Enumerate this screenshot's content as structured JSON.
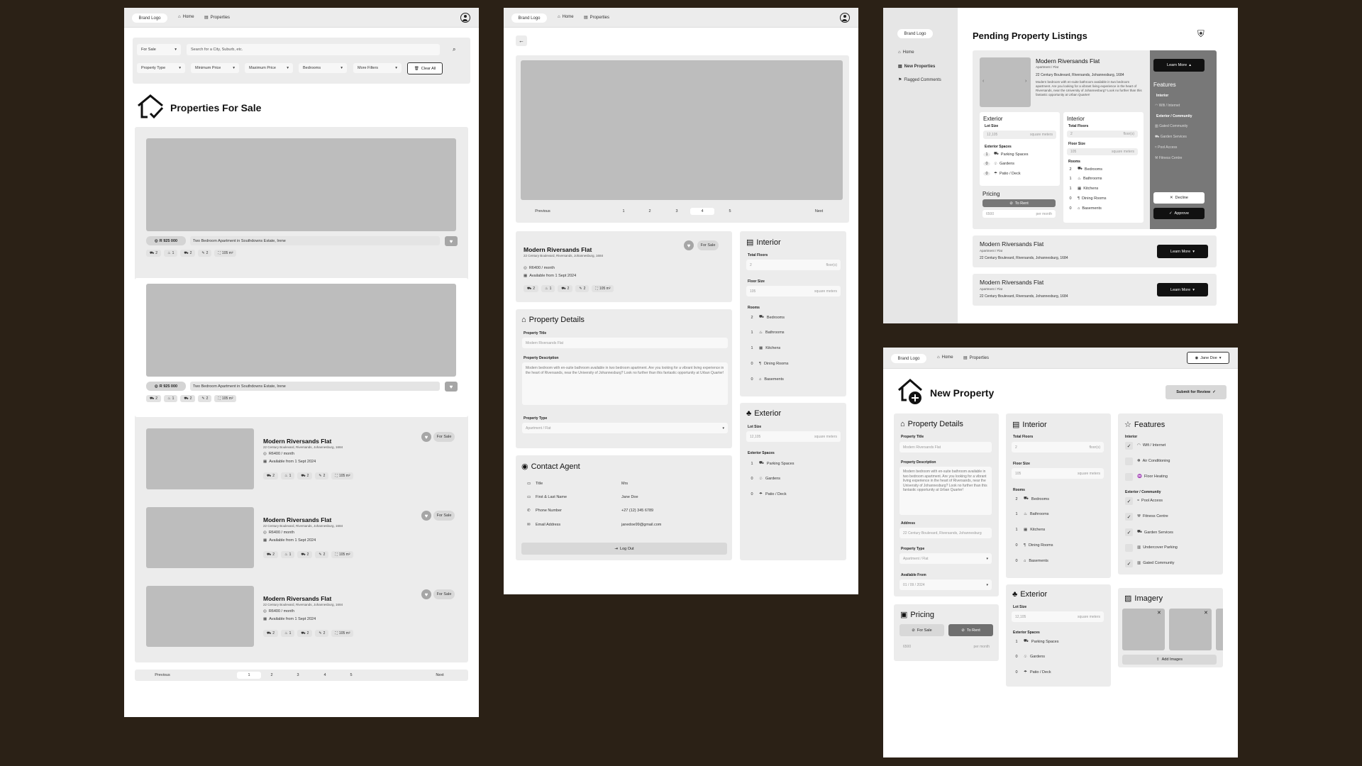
{
  "common": {
    "brand": "Brand Logo",
    "home": "Home",
    "properties": "Properties",
    "new_properties": "New Properties",
    "flagged": "Flagged Comments",
    "user": "Jane Doe"
  },
  "search": {
    "for_sale": "For Sale",
    "placeholder": "Search for a City, Suburb, etc.",
    "property_type": "Property Type",
    "min_price": "Minimum Price",
    "max_price": "Maximum Price",
    "bedrooms": "Bedrooms",
    "more_filters": "More Filters",
    "clear_all": "Clear All"
  },
  "list_page": {
    "heading": "Properties For Sale",
    "featured": [
      {
        "price": "R 925 000",
        "desc": "Two Bedroom Apartment in Southdowns Estate, Irene"
      },
      {
        "price": "R 925 000",
        "desc": "Two Bedroom Apartment in Southdowns Estate, Irene"
      }
    ],
    "chips": [
      "2",
      "1",
      "2",
      "2",
      "105 m²"
    ],
    "listings": [
      {
        "title": "Modern Riversands Flat",
        "address": "22 Century Boulevard, Riversands, Johannesburg, 1684",
        "price": "R6400 / month",
        "available": "Available from 1 Sept 2024",
        "tag": "For Sale"
      },
      {
        "title": "Modern Riversands Flat",
        "address": "22 Century Boulevard, Riversands, Johannesburg, 1684",
        "price": "R6400 / month",
        "available": "Available from 1 Sept 2024",
        "tag": "For Sale"
      },
      {
        "title": "Modern Riversands Flat",
        "address": "22 Century Boulevard, Riversands, Johannesburg, 1684",
        "price": "R6400 / month",
        "available": "Available from 1 Sept 2024",
        "tag": "For Sale"
      }
    ],
    "pager": {
      "prev": "Previous",
      "next": "Next",
      "pages": [
        "1",
        "2",
        "3",
        "4",
        "5"
      ],
      "active": 1
    }
  },
  "detail_page": {
    "pager": {
      "prev": "Previous",
      "next": "Next",
      "pages": [
        "1",
        "2",
        "3",
        "4",
        "5"
      ],
      "active": 4
    },
    "title": "Modern Riversands Flat",
    "address": "22 Century Boulevard, Riversands, Johannesburg, 1684",
    "price": "R6400 / month",
    "available": "Available from 1 Sept 2024",
    "tag": "For Sale",
    "details_heading": "Property Details",
    "property_title_label": "Property Title",
    "property_title_value": "Modern Riversands Flat",
    "desc_label": "Property Description",
    "desc_value": "Modern bedroom with en-suite bathroom available in two bedroom apartment. Are you looking for a vibrant living experience in the heart of Riversands, near the University of Johannesburg? Look no further than this fantastic opportunity at Urban Quarter!",
    "type_label": "Property Type",
    "type_value": "Apartment / Flat",
    "contact_heading": "Contact Agent",
    "contact": [
      {
        "label": "Title",
        "value": "Mrs"
      },
      {
        "label": "First & Last Name",
        "value": "Jane Doe"
      },
      {
        "label": "Phone Number",
        "value": "+27 (12) 345 6789"
      },
      {
        "label": "Email Address",
        "value": "janedoe99@gmail.com"
      }
    ],
    "logout": "Log Out",
    "interior_heading": "Interior",
    "total_floors": "Total Floors",
    "floors_val": "2",
    "floors_unit": "floor(s)",
    "floor_size": "Floor Size",
    "floor_size_val": "105",
    "sqm": "square meters",
    "rooms": "Rooms",
    "room_list": [
      {
        "n": "2",
        "label": "Bedrooms"
      },
      {
        "n": "1",
        "label": "Bathrooms"
      },
      {
        "n": "1",
        "label": "Kitchens"
      },
      {
        "n": "0",
        "label": "Dining Rooms"
      },
      {
        "n": "0",
        "label": "Basements"
      }
    ],
    "exterior_heading": "Exterior",
    "lot_size": "Lot Size",
    "lot_val": "12,105",
    "ext_spaces": "Exterior Spaces",
    "ext_list": [
      {
        "n": "1",
        "label": "Parking Spaces"
      },
      {
        "n": "0",
        "label": "Gardens"
      },
      {
        "n": "0",
        "label": "Patio / Deck"
      }
    ]
  },
  "pending_page": {
    "heading": "Pending Property Listings",
    "title": "Modern Riversands Flat",
    "subtitle": "Apartment / Flat",
    "address": "22 Century Boulevard, Riversands, Johannesburg, 1684",
    "desc": "Modern bedroom with en-suite bathroom available in two bedroom apartment. Are you looking for a vibrant living experience in the heart of Riversands, near the University of Johannesburg? Look no further than this fantastic opportunity at Urban Quarter!",
    "learn_more": "Learn More",
    "features": "Features",
    "interior": "Interior",
    "wifi": "Wifi / Internet",
    "ext_comm": "Exterior / Community",
    "gated": "Gated Community",
    "garden_services": "Garden Services",
    "pool": "Pool Access",
    "fitness": "Fitness Centre",
    "decline": "Decline",
    "approve": "Approve",
    "exterior": "Exterior",
    "pricing": "Pricing",
    "to_rent": "To Rent",
    "price_val": "6500",
    "per_month": "per month",
    "floors_val": "2",
    "lot_val": "12,105",
    "floor_size_val": "105",
    "ext_list": [
      {
        "n": "1",
        "label": "Parking Spaces"
      },
      {
        "n": "0",
        "label": "Gardens"
      },
      {
        "n": "0",
        "label": "Patio / Deck"
      }
    ],
    "room_list": [
      {
        "n": "2",
        "label": "Bedrooms"
      },
      {
        "n": "1",
        "label": "Bathrooms"
      },
      {
        "n": "1",
        "label": "Kitchens"
      },
      {
        "n": "0",
        "label": "Dining Rooms"
      },
      {
        "n": "0",
        "label": "Basements"
      }
    ]
  },
  "new_page": {
    "heading": "New Property",
    "submit": "Submit for Review",
    "address_label": "Address",
    "address_val": "22 Century Boulevard, Riversands, Johannesburg",
    "avail_label": "Available From",
    "avail_val": "01 / 09 / 2024",
    "pricing": "Pricing",
    "for_sale": "For Sale",
    "to_rent": "To Rent",
    "price_val": "6500",
    "per_month": "per month",
    "features": "Features",
    "interior": "Interior",
    "feat_int": [
      {
        "label": "Wifi / Internet",
        "on": true
      },
      {
        "label": "Air Conditioning",
        "on": false
      },
      {
        "label": "Floor Heating",
        "on": false
      }
    ],
    "ext_comm": "Exterior / Community",
    "feat_ext": [
      {
        "label": "Pool Access",
        "on": true
      },
      {
        "label": "Fitness Centre",
        "on": true
      },
      {
        "label": "Garden Services",
        "on": true
      },
      {
        "label": "Undercover Parking",
        "on": false
      },
      {
        "label": "Gated Community",
        "on": true
      }
    ],
    "imagery": "Imagery",
    "add_images": "Add Images"
  }
}
